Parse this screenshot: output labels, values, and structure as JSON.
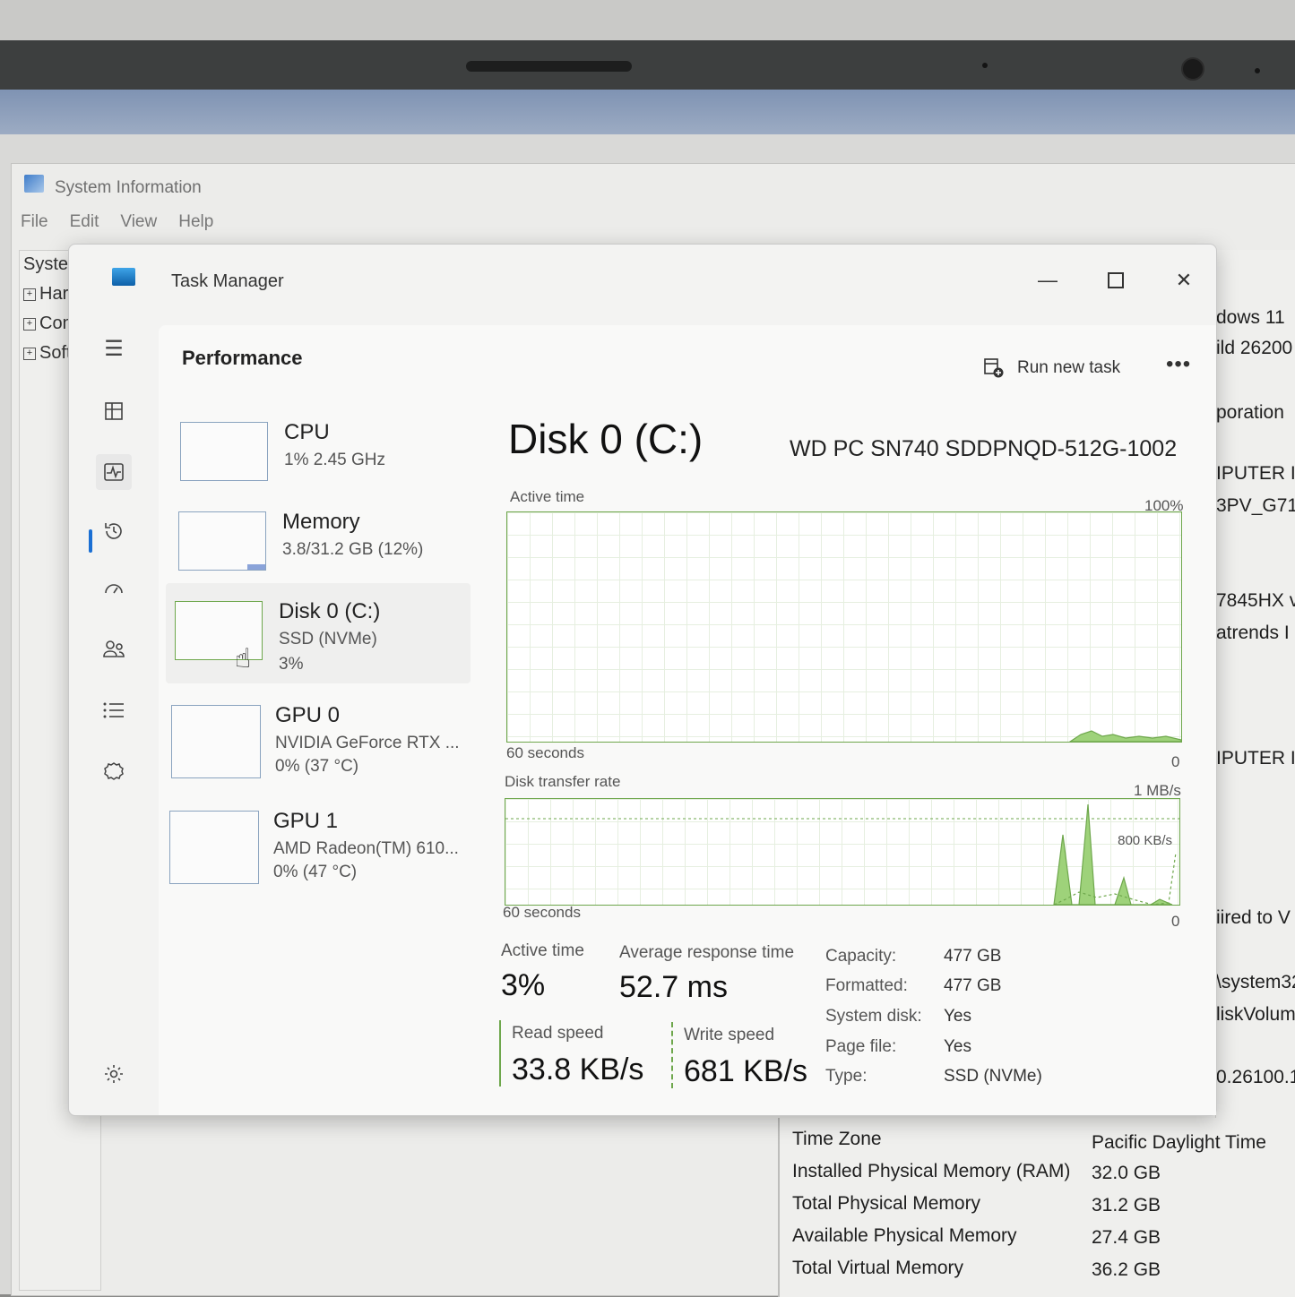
{
  "system_info": {
    "title": "System Information",
    "menu": [
      "File",
      "Edit",
      "View",
      "Help"
    ],
    "tree": [
      {
        "label": "System",
        "expandable": false
      },
      {
        "label": "Hardw",
        "expandable": true
      },
      {
        "label": "Comp",
        "expandable": true
      },
      {
        "label": "Softw",
        "expandable": true
      }
    ],
    "right_values": [
      "dows 11",
      "ild 26200",
      "poration",
      "IPUTER IN",
      "3PV_G71",
      "7845HX v",
      "atrends I",
      "IPUTER IN",
      "iired to V",
      "\\system32",
      "liskVolum",
      "0.26100.1"
    ],
    "bottom_rows": [
      {
        "name": "Time Zone",
        "value": "Pacific Daylight Time"
      },
      {
        "name": "Installed Physical Memory (RAM)",
        "value": "32.0 GB"
      },
      {
        "name": "Total Physical Memory",
        "value": "31.2 GB"
      },
      {
        "name": "Available Physical Memory",
        "value": "27.4 GB"
      },
      {
        "name": "Total Virtual Memory",
        "value": "36.2 GB"
      }
    ]
  },
  "task_manager": {
    "title": "Task Manager",
    "page_title": "Performance",
    "run_new_task": "Run new task",
    "more": "•••",
    "nav_icons": [
      "hamburger-icon",
      "processes-icon",
      "performance-icon",
      "app-history-icon",
      "startup-apps-icon",
      "users-icon",
      "details-icon",
      "services-icon",
      "settings-icon"
    ],
    "resources": [
      {
        "name": "CPU",
        "line2": "1%  2.45 GHz",
        "line3": ""
      },
      {
        "name": "Memory",
        "line2": "3.8/31.2 GB (12%)",
        "line3": ""
      },
      {
        "name": "Disk 0 (C:)",
        "line2": "SSD (NVMe)",
        "line3": "3%"
      },
      {
        "name": "GPU 0",
        "line2": "NVIDIA GeForce RTX ...",
        "line3": "0%  (37 °C)"
      },
      {
        "name": "GPU 1",
        "line2": "AMD Radeon(TM) 610...",
        "line3": "0%  (47 °C)"
      }
    ],
    "disk": {
      "title": "Disk 0 (C:)",
      "model": "WD PC SN740 SDDPNQD-512G-1002",
      "active_time_graph": {
        "label": "Active time",
        "max": "100%",
        "duration": "60 seconds",
        "min": "0"
      },
      "transfer_graph": {
        "label": "Disk transfer rate",
        "max": "1 MB/s",
        "marker": "800 KB/s",
        "duration": "60 seconds",
        "min": "0"
      },
      "stats": {
        "active_time_label": "Active time",
        "active_time": "3%",
        "response_label": "Average response time",
        "response": "52.7 ms",
        "read_label": "Read speed",
        "read": "33.8 KB/s",
        "write_label": "Write speed",
        "write": "681 KB/s"
      },
      "properties": [
        {
          "label": "Capacity:",
          "value": "477 GB"
        },
        {
          "label": "Formatted:",
          "value": "477 GB"
        },
        {
          "label": "System disk:",
          "value": "Yes"
        },
        {
          "label": "Page file:",
          "value": "Yes"
        },
        {
          "label": "Type:",
          "value": "SSD (NVMe)"
        }
      ]
    }
  },
  "colors": {
    "accent": "#1a6fd4",
    "graph_line": "#6ea74c",
    "graph_fill": "#9ed27a"
  }
}
